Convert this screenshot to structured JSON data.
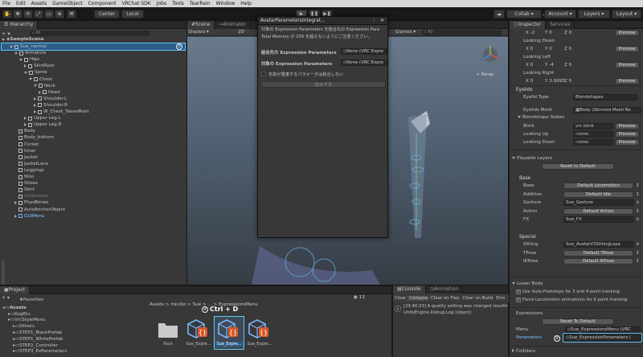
{
  "menubar": [
    "File",
    "Edit",
    "Assets",
    "GameObject",
    "Component",
    "VRChat SDK",
    "Jobs",
    "Tools",
    "TearRain",
    "Window",
    "Help"
  ],
  "toolbar": {
    "center": "Center",
    "local": "Local",
    "collab": "Collab",
    "account": "Account",
    "layers": "Layers",
    "layout": "Layout"
  },
  "hierarchy": {
    "title": "Hierarchy",
    "scene": "SampleScene",
    "search": "All",
    "items": [
      {
        "label": "Sue_normal",
        "depth": 1,
        "state": "open",
        "sel": true
      },
      {
        "label": "Armature",
        "depth": 2,
        "state": "open"
      },
      {
        "label": "Hips",
        "depth": 3,
        "state": "open"
      },
      {
        "label": "SkirtRoot",
        "depth": 4,
        "state": "closed"
      },
      {
        "label": "Spine",
        "depth": 4,
        "state": "open"
      },
      {
        "label": "Chest",
        "depth": 5,
        "state": "open"
      },
      {
        "label": "Neck",
        "depth": 6,
        "state": "open"
      },
      {
        "label": "Head",
        "depth": 7,
        "state": "closed"
      },
      {
        "label": "Shoulder.L",
        "depth": 6,
        "state": "closed"
      },
      {
        "label": "Shoulder.R",
        "depth": 6,
        "state": "closed"
      },
      {
        "label": "W_Chest_TasselRoot",
        "depth": 6,
        "state": "closed"
      },
      {
        "label": "Upper Leg.L",
        "depth": 4,
        "state": "closed"
      },
      {
        "label": "Upper Leg.R",
        "depth": 4,
        "state": "closed"
      },
      {
        "label": "Body",
        "depth": 2,
        "state": "none"
      },
      {
        "label": "Body_bottom",
        "depth": 2,
        "state": "none"
      },
      {
        "label": "Corset",
        "depth": 2,
        "state": "none"
      },
      {
        "label": "Inner",
        "depth": 2,
        "state": "none"
      },
      {
        "label": "Jacket",
        "depth": 2,
        "state": "none"
      },
      {
        "label": "JacketLace",
        "depth": 2,
        "state": "none"
      },
      {
        "label": "Leggings",
        "depth": 2,
        "state": "none"
      },
      {
        "label": "Niso",
        "depth": 2,
        "state": "none"
      },
      {
        "label": "Shoes",
        "depth": 2,
        "state": "none"
      },
      {
        "label": "Skirt",
        "depth": 2,
        "state": "none"
      },
      {
        "label": "Underwear",
        "depth": 2,
        "state": "none",
        "dim": true
      },
      {
        "label": "PhysBones",
        "depth": 2,
        "state": "closed"
      },
      {
        "label": "AutoAnchorObject",
        "depth": 2,
        "state": "none"
      },
      {
        "label": "GUIMenu",
        "depth": 2,
        "state": "closed",
        "blue": true
      }
    ],
    "marker": "①"
  },
  "scene": {
    "tab_scene": "Scene",
    "tab_animator": "Animator",
    "shading": "Shaded",
    "mode2d": "2D",
    "gizmos": "Gizmos",
    "search": "All",
    "persp": "< Persp"
  },
  "dialog": {
    "title": "AvatarParametersIntegrat...",
    "note1": "対象の Expression Parameters を結合先の Expression Para",
    "note2": "Total Memory が 256 を超えないようにご注意ください。",
    "dest_label": "結合先の Expression Parameters",
    "dest_value": "None (VRC Expre",
    "src_label": "対象の Expression Parameters",
    "src_value": "None (VRC Expre",
    "check_label": "名前が重複するパラメータは結合しない",
    "merge_button": "結合する"
  },
  "inspector": {
    "tab_inspector": "Inspector",
    "tab_services": "Services",
    "rows_top": [
      {
        "x": "X  -2",
        "y": "Y  0",
        "z": "Z  0",
        "btn": "Preview"
      },
      {
        "label": "Looking Down"
      },
      {
        "x": "X  0",
        "y": "Y  0",
        "z": "Z  0",
        "btn": "Preview"
      },
      {
        "label": "Looking Left"
      },
      {
        "x": "X  0",
        "y": "Y  -4",
        "z": "Z  0",
        "btn": "Preview"
      },
      {
        "label": "Looking Right"
      },
      {
        "x": "X  0",
        "y": "Y  3.9995",
        "z": "Z  0",
        "btn": "Preview"
      }
    ],
    "eyelids": "Eyelids",
    "eyelid_type_label": "Eyelid Type",
    "eyelid_type": "Blendshapes",
    "eyelids_mesh_label": "Eyelids Mesh",
    "eyelids_mesh": "Body (Skinned Mesh Re",
    "blendshape_states": "Blendshape States",
    "blink_label": "Blink",
    "blink": "vrc.blink",
    "lookup_label": "Looking Up",
    "lookup": "-none-",
    "lookdown_label": "Looking Down",
    "lookdown": "-none-",
    "preview": "Preview",
    "playable_layers": "Playable Layers",
    "reset_default": "Reset to Default",
    "base": "Base",
    "layers": [
      {
        "label": "Base",
        "value": "Default Locomotion",
        "btn": true
      },
      {
        "label": "Additive",
        "value": "Default Idle",
        "btn": true
      },
      {
        "label": "Gesture",
        "value": "Sue_Gesture",
        "btn": false
      },
      {
        "label": "Action",
        "value": "Default Action",
        "btn": true
      },
      {
        "label": "FX",
        "value": "Sue_FX",
        "btn": false
      }
    ],
    "special": "Special",
    "special_layers": [
      {
        "label": "Sitting",
        "value": "Sue_AvatarV3SittingLaye",
        "btn": false
      },
      {
        "label": "TPose",
        "value": "Default TPose",
        "btn": true
      },
      {
        "label": "IKPose",
        "value": "Default IKPose",
        "btn": true
      }
    ],
    "lower_body": "Lower Body",
    "auto_footsteps": "Use Auto-Footsteps for 3 and 4 point tracking",
    "force_locomotion": "Force Locomotion animations for 6 point tracking",
    "expressions": "Expressions",
    "reset_default2": "Reset To Default",
    "menu_label": "Menu",
    "menu_value": "Sue_ExpressionsMenu (VRC",
    "params_label": "Parameters",
    "params_value": "Sue_ExpressionParameters (",
    "marker2": "②",
    "colliders": "Colliders"
  },
  "project": {
    "tab_project": "Project",
    "breadcrumb": "Assets > mio3io > Sue > ... > ExpressionsMenu",
    "count": "13",
    "tree": [
      {
        "label": "Favorites",
        "depth": 0
      },
      {
        "label": "Assets",
        "depth": 0,
        "bold": true
      },
      {
        "label": "KogEtu",
        "depth": 1
      },
      {
        "label": "VrcStyleMenu",
        "depth": 1
      },
      {
        "label": "Others",
        "depth": 2
      },
      {
        "label": "STEP1_BlackPrefab",
        "depth": 2
      },
      {
        "label": "STEP1_WhitePrefab",
        "depth": 2
      },
      {
        "label": "STEP2_Controller",
        "depth": 2
      },
      {
        "label": "STEP3_ExParameters",
        "depth": 2
      }
    ],
    "assets": [
      {
        "label": "Face",
        "kind": "folder"
      },
      {
        "label": "Sue_Expre...",
        "kind": "menu"
      },
      {
        "label": "Sue_Expre...",
        "kind": "param",
        "sel": true
      },
      {
        "label": "Sue_Expre...",
        "kind": "param"
      }
    ],
    "shortcut": "Ctrl + D",
    "marker3": "③"
  },
  "console": {
    "tab_console": "Console",
    "tab_animation": "Animation",
    "clear": "Clear",
    "collapse": "Collapse",
    "clear_on_play": "Clear on Play",
    "clear_on_build": "Clear on Build",
    "errors": "Erro",
    "log1": "[23:40:23] A quality setting was changed resulting",
    "log2": "UnityEngine.Debug:Log (object)"
  }
}
